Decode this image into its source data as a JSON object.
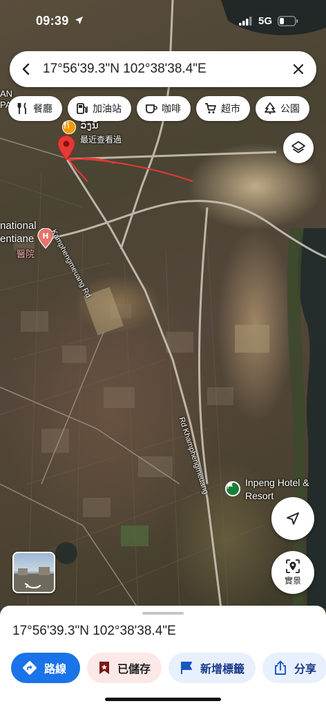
{
  "status_bar": {
    "time": "09:39",
    "network": "5G"
  },
  "search": {
    "query": "17°56'39.3\"N 102°38'38.4\"E",
    "back_icon": "back-arrow-icon",
    "clear_icon": "close-icon"
  },
  "chips": [
    {
      "label": "餐廳",
      "icon": "restaurant-icon"
    },
    {
      "label": "加油站",
      "icon": "gas-station-icon"
    },
    {
      "label": "咖啡",
      "icon": "coffee-icon"
    },
    {
      "label": "超市",
      "icon": "cart-icon"
    },
    {
      "label": "公園",
      "icon": "park-icon"
    }
  ],
  "map": {
    "place_lao": "ວັງນັ້",
    "recent_label": "最近查看過",
    "hospital_name_1": "national",
    "hospital_name_2": "entiane",
    "hospital_label": "醫院",
    "road_1": "Kamphengmeuang Rd",
    "road_2": "Rd Khamphengmeuang",
    "hotel_line1": "Inpeng Hotel &",
    "hotel_line2": "Resort",
    "edge_text_1": "AN",
    "edge_text_2": "PA",
    "pin_color": "#e53935",
    "hotel_pin_color": "#188038",
    "annotation_color": "#e53935"
  },
  "controls": {
    "street_view_label": "實景"
  },
  "sheet": {
    "title": "17°56'39.3\"N 102°38'38.4\"E",
    "actions": {
      "directions": "路線",
      "saved": "已儲存",
      "add_label": "新增標籤",
      "share": "分享"
    }
  },
  "colors": {
    "accent": "#1a73e8",
    "saved_bg": "#fce8e6"
  }
}
